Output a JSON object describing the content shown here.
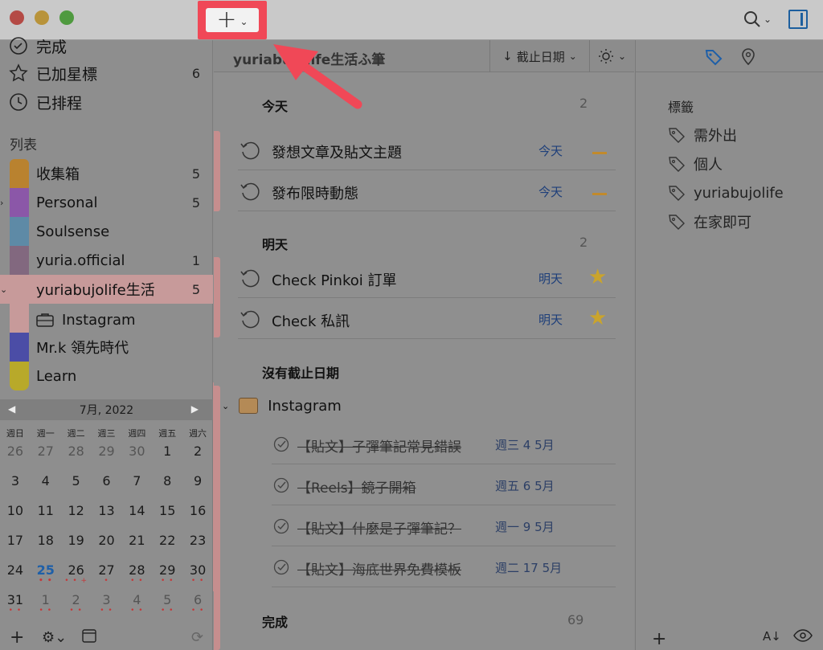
{
  "toolbar": {
    "add_chevron": "⌄",
    "search_chevron": "⌄"
  },
  "sidebar": {
    "smart_lists": [
      {
        "label": "完成",
        "count": ""
      },
      {
        "label": "已加星標",
        "count": "6"
      },
      {
        "label": "已排程",
        "count": ""
      }
    ],
    "lists_header": "列表",
    "lists": [
      {
        "label": "收集箱",
        "count": "5",
        "color": "#b9822f"
      },
      {
        "label": "Personal",
        "count": "5",
        "color": "#8b57a8"
      },
      {
        "label": "Soulsense",
        "count": "",
        "color": "#5e8aa6"
      },
      {
        "label": "yuria.official",
        "count": "1",
        "color": "#82687f"
      },
      {
        "label": "yuriabujolife生活",
        "count": "5",
        "color": "#c79a9a"
      },
      {
        "label": "Mr.k 領先時代",
        "count": "",
        "color": "#4b4da6"
      },
      {
        "label": "Learn",
        "count": "",
        "color": "#b8a92a"
      }
    ],
    "sub_item": "Instagram"
  },
  "calendar": {
    "month": "7月, 2022",
    "weekdays": [
      "週日",
      "週一",
      "週二",
      "週三",
      "週四",
      "週五",
      "週六"
    ],
    "days": [
      {
        "d": "26",
        "m": true
      },
      {
        "d": "27",
        "m": true
      },
      {
        "d": "28",
        "m": true
      },
      {
        "d": "29",
        "m": true
      },
      {
        "d": "30",
        "m": true
      },
      {
        "d": "1"
      },
      {
        "d": "2"
      },
      {
        "d": "3"
      },
      {
        "d": "4"
      },
      {
        "d": "5"
      },
      {
        "d": "6"
      },
      {
        "d": "7"
      },
      {
        "d": "8"
      },
      {
        "d": "9"
      },
      {
        "d": "10"
      },
      {
        "d": "11"
      },
      {
        "d": "12"
      },
      {
        "d": "13"
      },
      {
        "d": "14"
      },
      {
        "d": "15"
      },
      {
        "d": "16"
      },
      {
        "d": "17"
      },
      {
        "d": "18"
      },
      {
        "d": "19"
      },
      {
        "d": "20"
      },
      {
        "d": "21"
      },
      {
        "d": "22"
      },
      {
        "d": "23"
      },
      {
        "d": "24"
      },
      {
        "d": "25",
        "t": true,
        "dots": "• •"
      },
      {
        "d": "26",
        "dots": "• • +"
      },
      {
        "d": "27",
        "dots": "•"
      },
      {
        "d": "28",
        "dots": "• •"
      },
      {
        "d": "29",
        "dots": "• •"
      },
      {
        "d": "30",
        "dots": "• •"
      },
      {
        "d": "31",
        "dots": "• •"
      },
      {
        "d": "1",
        "m": true,
        "dots": "• •"
      },
      {
        "d": "2",
        "m": true,
        "dots": "• •"
      },
      {
        "d": "3",
        "m": true,
        "dots": "• •"
      },
      {
        "d": "4",
        "m": true,
        "dots": "• •"
      },
      {
        "d": "5",
        "m": true,
        "dots": "• •"
      },
      {
        "d": "6",
        "m": true,
        "dots": "• •"
      }
    ]
  },
  "main": {
    "title": "yuriabujolife生活ふ筆",
    "sort_label": "截止日期",
    "groups": {
      "today": {
        "label": "今天",
        "count": "2"
      },
      "tomorrow": {
        "label": "明天",
        "count": "2"
      },
      "no_due": {
        "label": "沒有截止日期"
      },
      "done": {
        "label": "完成",
        "count": "69"
      }
    },
    "tasks_today": [
      {
        "title": "發想文章及貼文主題",
        "due": "今天"
      },
      {
        "title": "發布限時動態",
        "due": "今天"
      }
    ],
    "tasks_tomorrow": [
      {
        "title": "Check Pinkoi 訂單",
        "due": "明天"
      },
      {
        "title": "Check 私訊",
        "due": "明天"
      }
    ],
    "project": "Instagram",
    "completed": [
      {
        "title": "【貼文】子彈筆記常見錯誤",
        "date": "週三 4 5月"
      },
      {
        "title": "【Reels】鏡子開箱",
        "date": "週五 6 5月"
      },
      {
        "title": "【貼文】什麼是子彈筆記？",
        "date": "週一 9 5月"
      },
      {
        "title": "【貼文】海底世界免費模板",
        "date": "週二 17 5月"
      }
    ]
  },
  "inspector": {
    "label": "標籤",
    "tags": [
      "需外出",
      "個人",
      "yuriabujolife",
      "在家即可"
    ],
    "sort_label": "A↓"
  },
  "colors": {
    "accent": "#1e5fa8",
    "highlight": "#f04857",
    "star": "#caa42c"
  }
}
